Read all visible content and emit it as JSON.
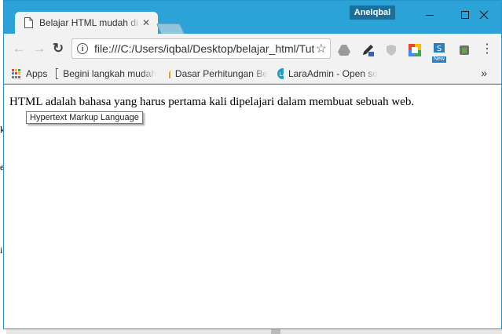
{
  "profile": {
    "name": "AneIqbal"
  },
  "tab": {
    "title": "Belajar HTML mudah di Android",
    "close": "✕"
  },
  "toolbar": {
    "back": "←",
    "forward": "→",
    "reload": "↻",
    "url": "file:///C:/Users/iqbal/Desktop/belajar_html/Tutorial.html",
    "star": "☆",
    "menu": "⋮"
  },
  "extensions": {
    "new_badge": "New"
  },
  "bookmarks": {
    "items": [
      {
        "label": "Apps",
        "icon": "apps-grid-icon"
      },
      {
        "label": "Begini langkah mudah",
        "icon": "page-icon"
      },
      {
        "label": "Dasar Perhitungan Be",
        "icon": "bookmark-hand-icon"
      },
      {
        "label": "LaraAdmin - Open so",
        "icon": "laraadmin-icon"
      }
    ],
    "overflow": "»"
  },
  "page": {
    "text": "HTML adalah bahasa yang harus pertama kali dipelajari dalam membuat sebuah web.",
    "tooltip": "Hypertext Markup Language"
  },
  "colors": {
    "titlebar": "#2ba2d8",
    "profile": "#1b6f99",
    "toolbar": "#f2f2f2"
  }
}
